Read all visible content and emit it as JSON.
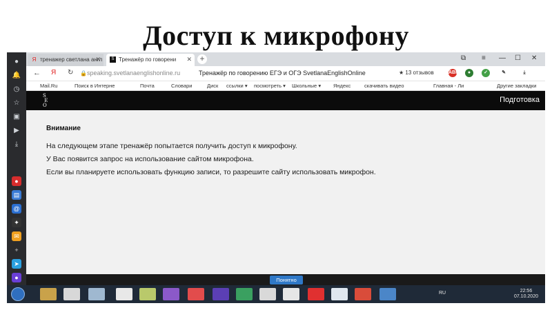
{
  "slide": {
    "title": "Доступ к микрофону"
  },
  "browser": {
    "tabs": [
      {
        "label": "тренажер светлана англ"
      },
      {
        "label": "Тренажёр по говорени"
      }
    ],
    "address": {
      "url": "speaking.svetlanaenglishonline.ru",
      "page_title": "Тренажёр по говорению ЕГЭ и ОГЭ SvetlanaEnglishOnline",
      "reviews": "★ 13 отзывов"
    },
    "bookmarks": [
      "Mail.Ru",
      "Поиск в Интерне",
      "Почта",
      "Словари",
      "Диск",
      "ссылки ▾",
      "посмотреть ▾",
      "Школьные ▾",
      "Яндекс",
      "скачивать видео",
      "Главная - Ли",
      "Другие закладки"
    ]
  },
  "page": {
    "header_right": "Подготовка",
    "notice_title": "Внимание",
    "lines": [
      "На следующем этапе тренажёр попытается получить доступ к микрофону.",
      "У Вас появится запрос на использование сайтом микрофона.",
      "Если вы планируете использовать функцию записи, то разрешите сайту использовать микрофон."
    ],
    "next_button": "Понятно"
  },
  "taskbar": {
    "lang": "RU",
    "time": "22:56",
    "date": "07.10.2020"
  },
  "colors": {
    "accent_button": "#2f78c7",
    "header_bg": "#0b0b0b",
    "content_bg": "#f1f1f1"
  }
}
